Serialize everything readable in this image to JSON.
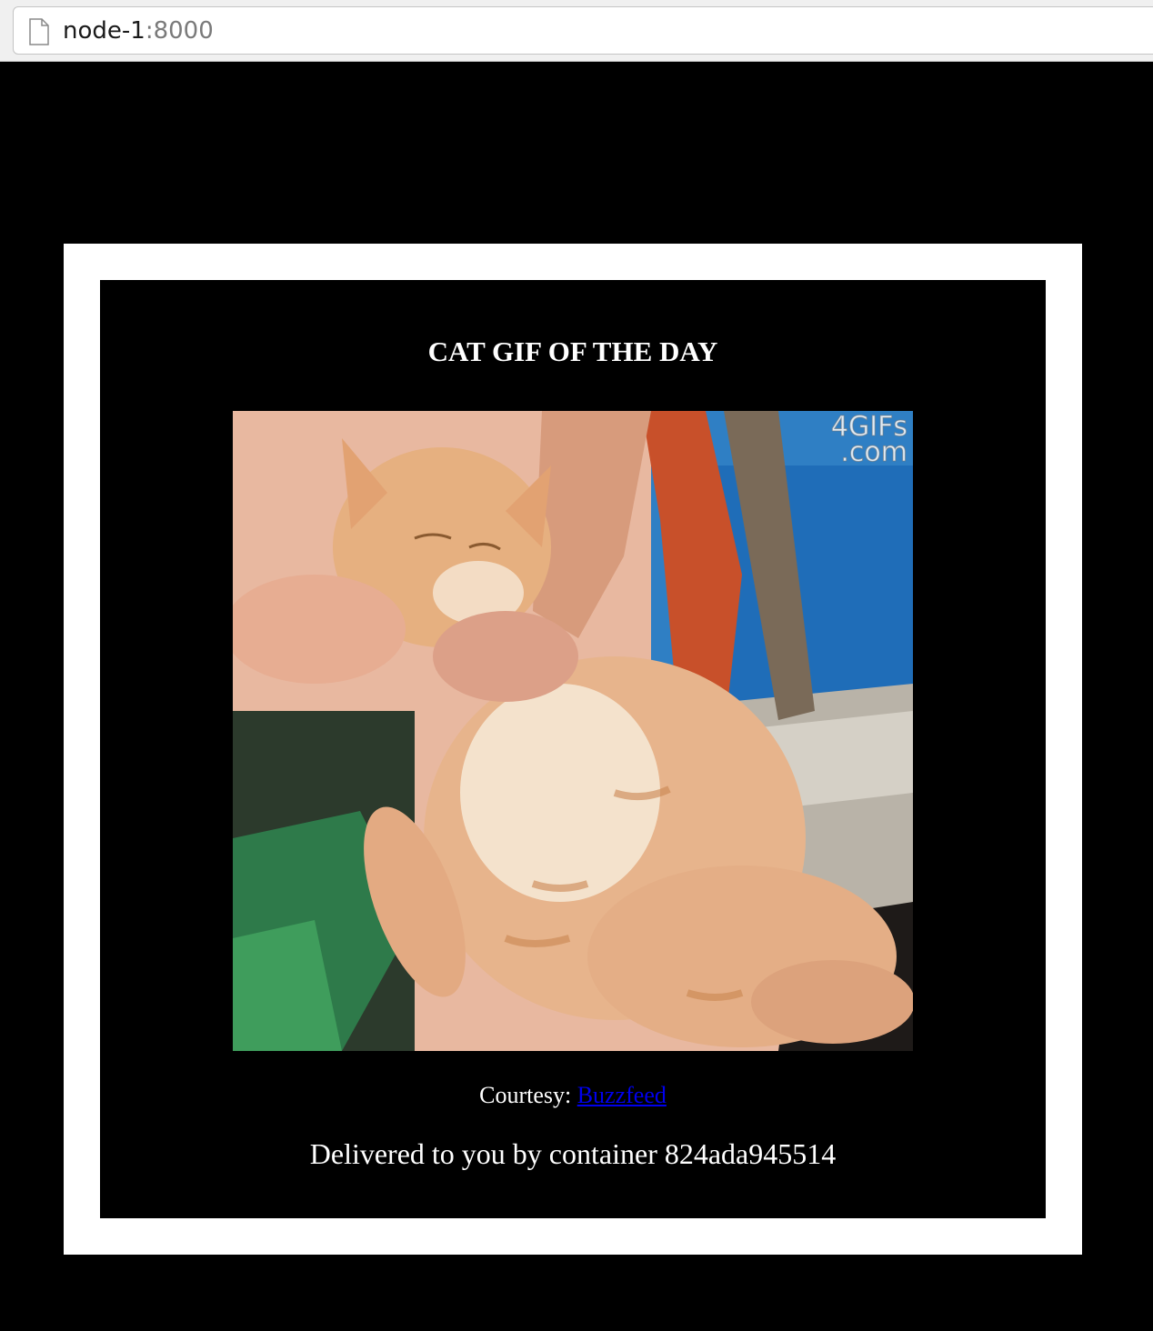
{
  "browser": {
    "url_host": "node-1",
    "url_port": ":8000"
  },
  "page": {
    "title": "CAT GIF OF THE DAY",
    "gif_watermark_line1": "4GIFs",
    "gif_watermark_line2": ".com",
    "courtesy_label": "Courtesy: ",
    "courtesy_link": "Buzzfeed",
    "delivered_text": "Delivered to you by container 824ada945514"
  },
  "colors": {
    "page_background": "#000000",
    "frame": "#ffffff",
    "link": "#0000ee"
  }
}
